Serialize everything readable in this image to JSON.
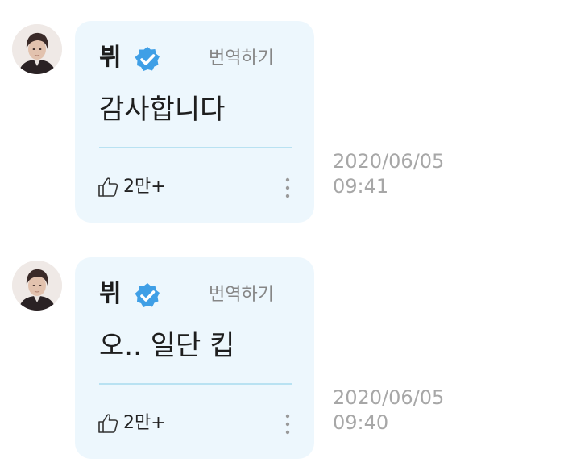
{
  "messages": [
    {
      "author": "뷔",
      "translate_label": "번역하기",
      "text": "감사합니다",
      "likes": "2만+",
      "date": "2020/06/05",
      "time": "09:41"
    },
    {
      "author": "뷔",
      "translate_label": "번역하기",
      "text": "오.. 일단 킵",
      "likes": "2만+",
      "date": "2020/06/05",
      "time": "09:40"
    }
  ],
  "icons": {
    "verified": "verified-badge-icon",
    "like": "thumbs-up-icon",
    "more": "more-vertical-icon"
  },
  "colors": {
    "bubble_bg": "#edf7fd",
    "verified_blue": "#3f9fe6",
    "divider": "#b9e2f2",
    "timestamp": "#a7a7a7"
  }
}
